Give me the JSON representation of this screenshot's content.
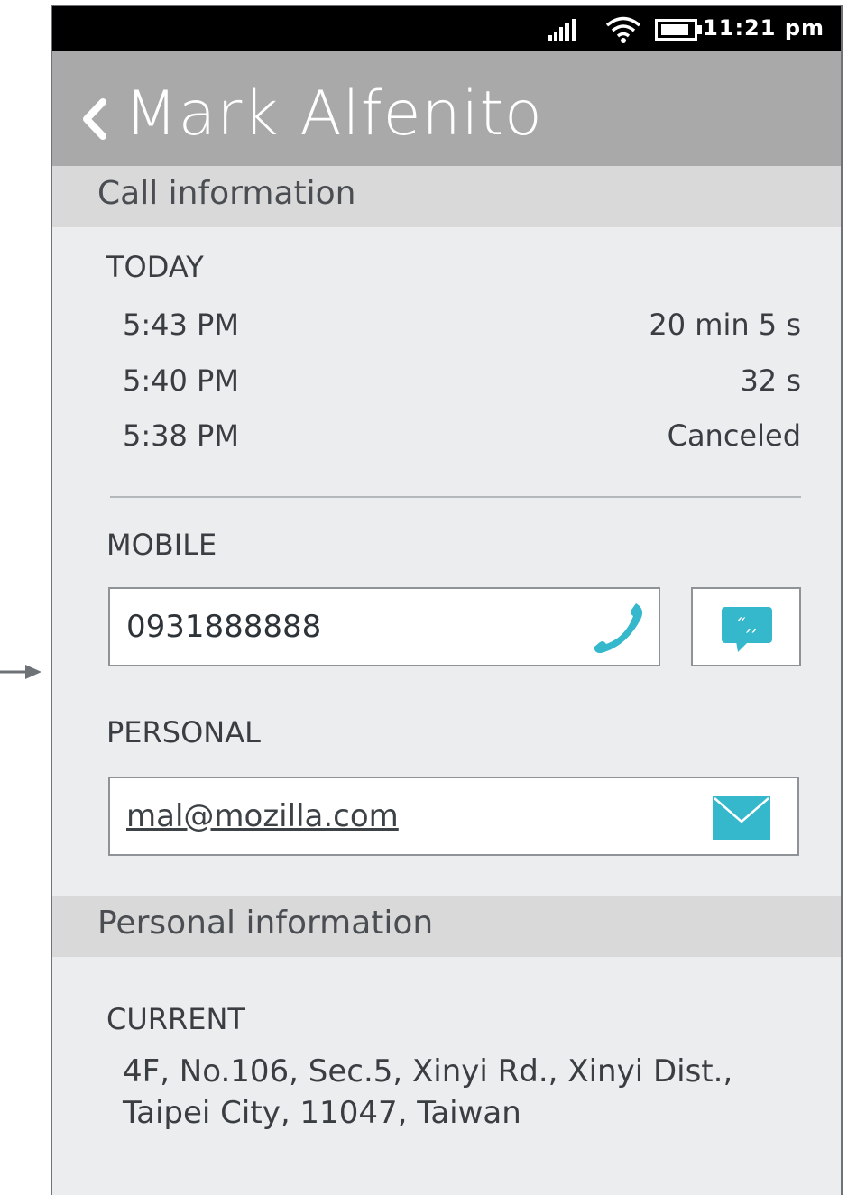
{
  "status_bar": {
    "time": "11:21 pm",
    "icons": [
      "signal-icon",
      "wifi-icon",
      "battery-icon"
    ]
  },
  "header": {
    "title": "Mark Alfenito",
    "back_icon": "chevron-left-icon"
  },
  "sections": {
    "call_information": "Call information",
    "personal_information": "Personal information"
  },
  "call_log": {
    "group_label": "TODAY",
    "entries": [
      {
        "time": "5:43 PM",
        "duration": "20 min 5 s"
      },
      {
        "time": "5:40 PM",
        "duration": "32 s"
      },
      {
        "time": "5:38 PM",
        "duration": "Canceled"
      }
    ]
  },
  "mobile": {
    "label": "MOBILE",
    "number": "0931888888",
    "call_icon": "phone-icon",
    "message_icon": "message-bubble-icon"
  },
  "personal": {
    "label": "PERSONAL",
    "email": "mal@mozilla.com",
    "email_icon": "envelope-icon"
  },
  "address": {
    "label": "CURRENT",
    "line1": "4F, No.106, Sec.5, Xinyi Rd., Xinyi Dist.,",
    "line2": "Taipei City, 11047, Taiwan"
  },
  "colors": {
    "accent": "#35b8cc",
    "header_bg": "#a9a9a9",
    "band_bg": "#d9d9d9",
    "body_bg": "#ebedef"
  }
}
